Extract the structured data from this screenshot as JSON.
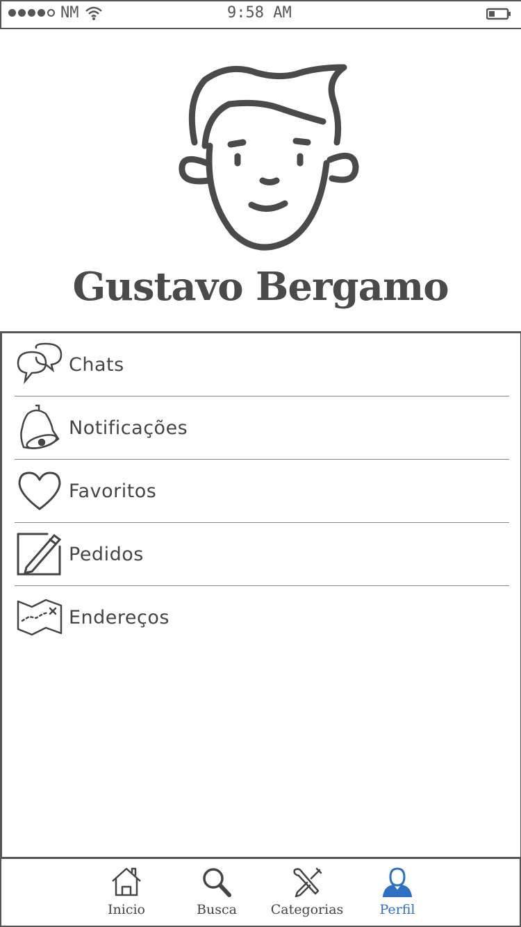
{
  "status_bar": {
    "carrier": "NM",
    "time": "9:58 AM"
  },
  "profile": {
    "name": "Gustavo Bergamo"
  },
  "menu": {
    "items": [
      {
        "label": "Chats",
        "icon": "chat-bubbles-icon"
      },
      {
        "label": "Notificações",
        "icon": "bell-icon"
      },
      {
        "label": "Favoritos",
        "icon": "heart-icon"
      },
      {
        "label": "Pedidos",
        "icon": "pencil-square-icon"
      },
      {
        "label": "Endereços",
        "icon": "map-icon"
      }
    ]
  },
  "tabbar": {
    "tabs": [
      {
        "label": "Inicio",
        "icon": "home-icon"
      },
      {
        "label": "Busca",
        "icon": "search-icon"
      },
      {
        "label": "Categorias",
        "icon": "tools-icon"
      },
      {
        "label": "Perfil",
        "icon": "user-icon",
        "active": true
      }
    ]
  },
  "colors": {
    "ink": "#4a4a4a",
    "active": "#2f6fc4"
  }
}
